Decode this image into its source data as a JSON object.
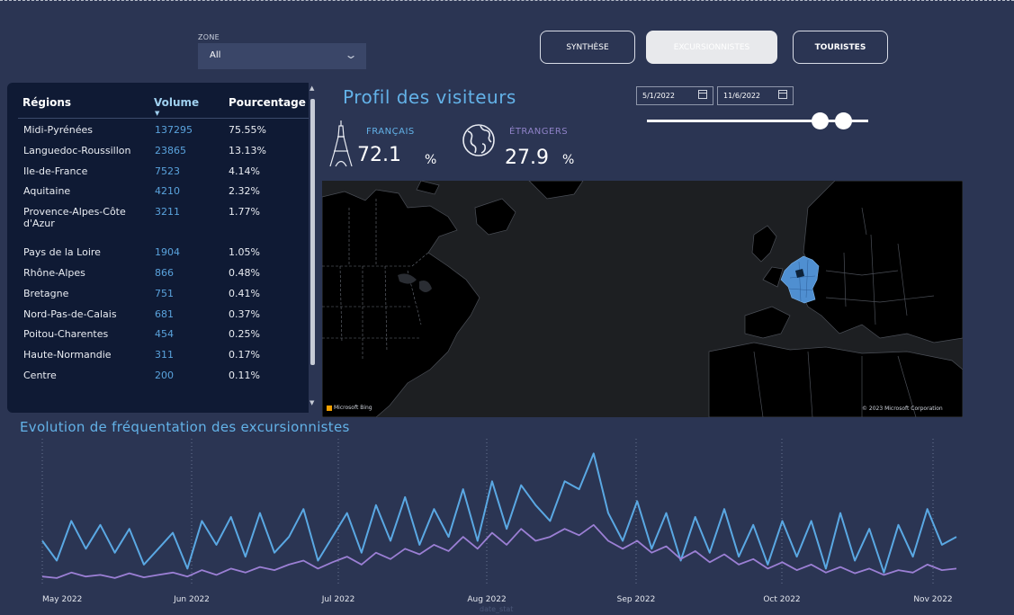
{
  "filters": {
    "zone_label": "ZONE",
    "zone_value": "All"
  },
  "nav": {
    "synthese": "SYNTHÈSE",
    "excursionnistes": "EXCURSIONNISTES",
    "touristes": "TOURISTES"
  },
  "regions_table": {
    "headers": {
      "region": "Régions",
      "volume": "Volume",
      "percentage": "Pourcentage"
    },
    "rows": [
      {
        "region": "Midi-Pyrénées",
        "volume": "137295",
        "percentage": "75.55%"
      },
      {
        "region": "Languedoc-Roussillon",
        "volume": "23865",
        "percentage": "13.13%"
      },
      {
        "region": "Ile-de-France",
        "volume": "7523",
        "percentage": "4.14%"
      },
      {
        "region": "Aquitaine",
        "volume": "4210",
        "percentage": "2.32%"
      },
      {
        "region": "Provence-Alpes-Côte d'Azur",
        "volume": "3211",
        "percentage": "1.77%"
      },
      {
        "region": "Pays de la Loire",
        "volume": "1904",
        "percentage": "1.05%"
      },
      {
        "region": "Rhône-Alpes",
        "volume": "866",
        "percentage": "0.48%"
      },
      {
        "region": "Bretagne",
        "volume": "751",
        "percentage": "0.41%"
      },
      {
        "region": "Nord-Pas-de-Calais",
        "volume": "681",
        "percentage": "0.37%"
      },
      {
        "region": "Poitou-Charentes",
        "volume": "454",
        "percentage": "0.25%"
      },
      {
        "region": "Haute-Normandie",
        "volume": "311",
        "percentage": "0.17%"
      },
      {
        "region": "Centre",
        "volume": "200",
        "percentage": "0.11%"
      }
    ]
  },
  "profile": {
    "title": "Profil des visiteurs",
    "french_label": "FRANÇAIS",
    "french_value": "72.1",
    "french_unit": "%",
    "foreign_label": "ÉTRANGERS",
    "foreign_value": "27.9",
    "foreign_unit": "%"
  },
  "date_range": {
    "start": "5/1/2022",
    "end": "11/6/2022"
  },
  "map": {
    "attribution": "Microsoft Bing",
    "copyright": "© 2023 Microsoft Corporation"
  },
  "colors": {
    "background": "#2b3553",
    "accent_blue": "#63b2e8",
    "accent_purple": "#8f82c8",
    "table_bg": "#0f1a34"
  },
  "chart_data": {
    "type": "line",
    "title": "Evolution de fréquentation des excursionnistes",
    "xlabel": "date_stat",
    "ylabel": "",
    "x_ticks": [
      "May 2022",
      "Jun 2022",
      "Jul 2022",
      "Aug 2022",
      "Sep 2022",
      "Oct 2022",
      "Nov 2022"
    ],
    "x": [
      "2022-05-01",
      "2022-05-04",
      "2022-05-07",
      "2022-05-10",
      "2022-05-13",
      "2022-05-16",
      "2022-05-19",
      "2022-05-22",
      "2022-05-25",
      "2022-05-28",
      "2022-05-31",
      "2022-06-03",
      "2022-06-06",
      "2022-06-09",
      "2022-06-12",
      "2022-06-15",
      "2022-06-18",
      "2022-06-21",
      "2022-06-24",
      "2022-06-27",
      "2022-06-30",
      "2022-07-03",
      "2022-07-06",
      "2022-07-09",
      "2022-07-12",
      "2022-07-15",
      "2022-07-18",
      "2022-07-21",
      "2022-07-24",
      "2022-07-27",
      "2022-07-30",
      "2022-08-02",
      "2022-08-05",
      "2022-08-08",
      "2022-08-11",
      "2022-08-14",
      "2022-08-17",
      "2022-08-20",
      "2022-08-23",
      "2022-08-26",
      "2022-08-29",
      "2022-09-01",
      "2022-09-04",
      "2022-09-07",
      "2022-09-10",
      "2022-09-13",
      "2022-09-16",
      "2022-09-19",
      "2022-09-22",
      "2022-09-25",
      "2022-09-28",
      "2022-10-01",
      "2022-10-04",
      "2022-10-07",
      "2022-10-10",
      "2022-10-13",
      "2022-10-16",
      "2022-10-19",
      "2022-10-22",
      "2022-10-25",
      "2022-10-28",
      "2022-10-31",
      "2022-11-03",
      "2022-11-06"
    ],
    "series": [
      {
        "values": [
          55,
          30,
          80,
          45,
          75,
          40,
          70,
          25,
          45,
          65,
          20,
          80,
          50,
          85,
          35,
          90,
          40,
          60,
          95,
          30,
          60,
          90,
          40,
          100,
          55,
          110,
          50,
          95,
          60,
          120,
          55,
          130,
          70,
          125,
          100,
          80,
          130,
          120,
          165,
          90,
          55,
          105,
          45,
          90,
          30,
          85,
          40,
          95,
          35,
          75,
          25,
          80,
          35,
          80,
          20,
          90,
          30,
          70,
          15,
          75,
          35,
          95,
          50,
          60
        ],
        "color": "#5aa8e3"
      },
      {
        "values": [
          10,
          8,
          15,
          10,
          12,
          8,
          14,
          9,
          12,
          15,
          10,
          18,
          12,
          20,
          15,
          22,
          18,
          25,
          30,
          20,
          28,
          35,
          25,
          40,
          32,
          45,
          38,
          50,
          42,
          60,
          45,
          65,
          50,
          70,
          55,
          60,
          70,
          62,
          75,
          55,
          45,
          55,
          40,
          48,
          32,
          42,
          28,
          38,
          25,
          32,
          20,
          28,
          18,
          25,
          15,
          22,
          14,
          20,
          12,
          18,
          15,
          25,
          18,
          20
        ],
        "color": "#9b7fd4"
      }
    ]
  }
}
